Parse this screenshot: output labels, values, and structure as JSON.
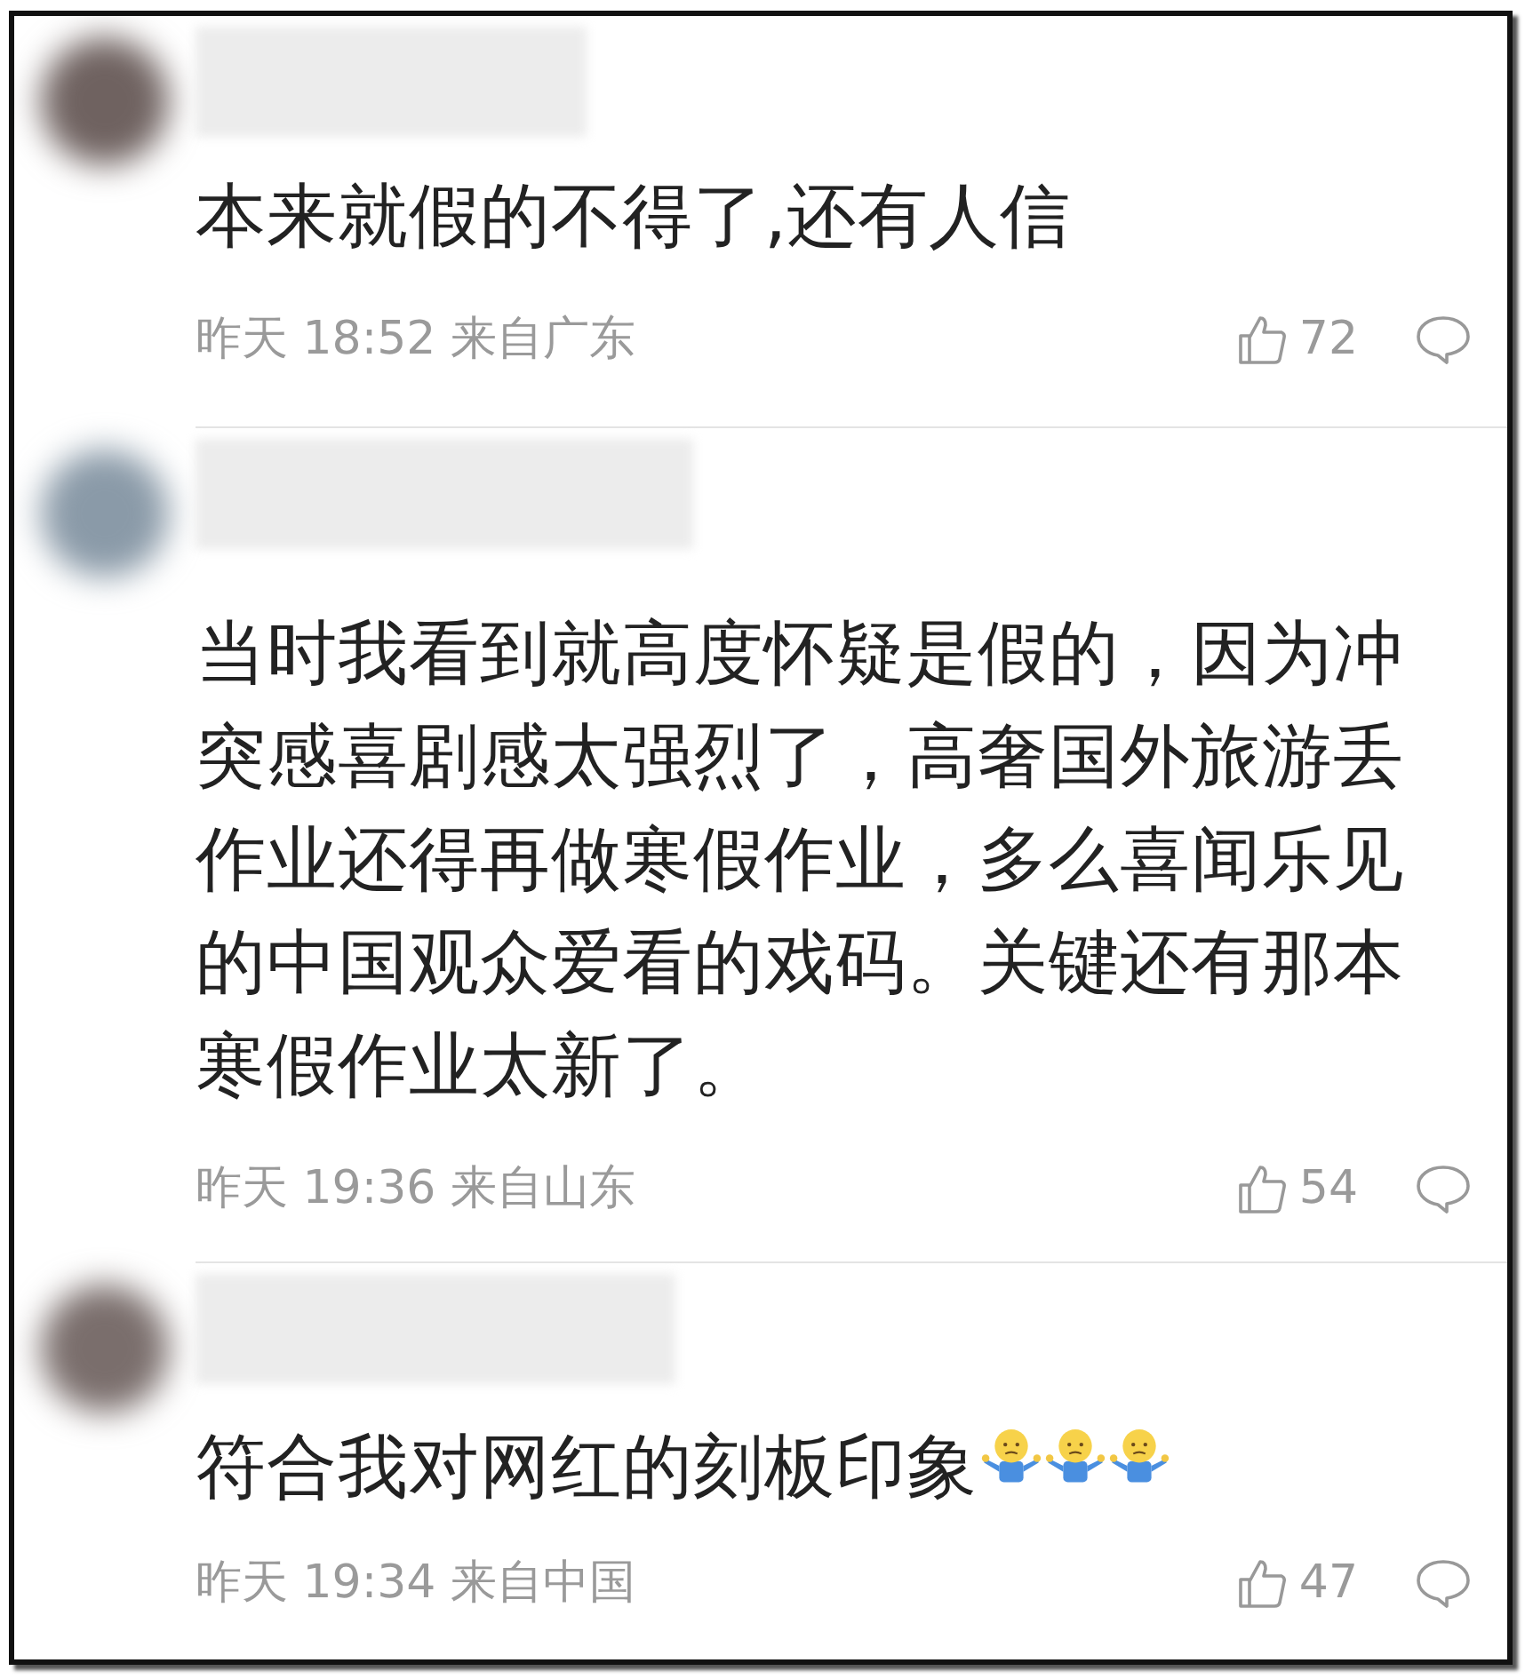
{
  "comments": [
    {
      "text": "本来就假的不得了,还有人信",
      "time": "昨天 18:52 来自广东",
      "likes": "72"
    },
    {
      "text": "当时我看到就高度怀疑是假的，因为冲突感喜剧感太强烈了，高奢国外旅游丢作业还得再做寒假作业，多么喜闻乐见的中国观众爱看的戏码。关键还有那本寒假作业太新了。",
      "time": "昨天 19:36 来自山东",
      "likes": "54"
    },
    {
      "text": "符合我对网红的刻板印象",
      "trailing_emojis": [
        {
          "kind": "shrug"
        },
        {
          "kind": "shrug"
        },
        {
          "kind": "shrug"
        }
      ],
      "time": "昨天 19:34 来自中国",
      "likes": "47"
    }
  ]
}
